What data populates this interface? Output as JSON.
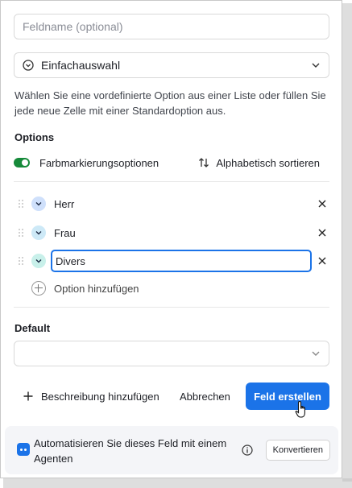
{
  "field_name": {
    "placeholder": "Feldname (optional)",
    "value": ""
  },
  "field_type": {
    "label": "Einfachauswahl",
    "icon": "circle-check-icon"
  },
  "description": "Wählen Sie eine vordefinierte Option aus einer Liste oder füllen Sie jede neue Zelle mit einer Standardoption aus.",
  "options_section": {
    "title": "Options",
    "color_toggle_label": "Farbmarkierungsoptionen",
    "color_toggle_on": true,
    "sort_label": "Alphabetisch sortieren",
    "items": [
      {
        "label": "Herr",
        "color": "#cfe0fb"
      },
      {
        "label": "Frau",
        "color": "#cde9f7"
      },
      {
        "label": "Divers",
        "color": "#c8f0ea"
      }
    ],
    "add_label": "Option hinzufügen"
  },
  "default_section": {
    "title": "Default",
    "value": ""
  },
  "footer": {
    "add_description": "Beschreibung hinzufügen",
    "cancel": "Abbrechen",
    "create": "Feld erstellen"
  },
  "agent": {
    "text": "Automatisieren Sie dieses Feld mit einem Agenten",
    "button": "Konvertieren"
  },
  "colors": {
    "accent": "#1b73e8",
    "toggle": "#168a3a"
  }
}
